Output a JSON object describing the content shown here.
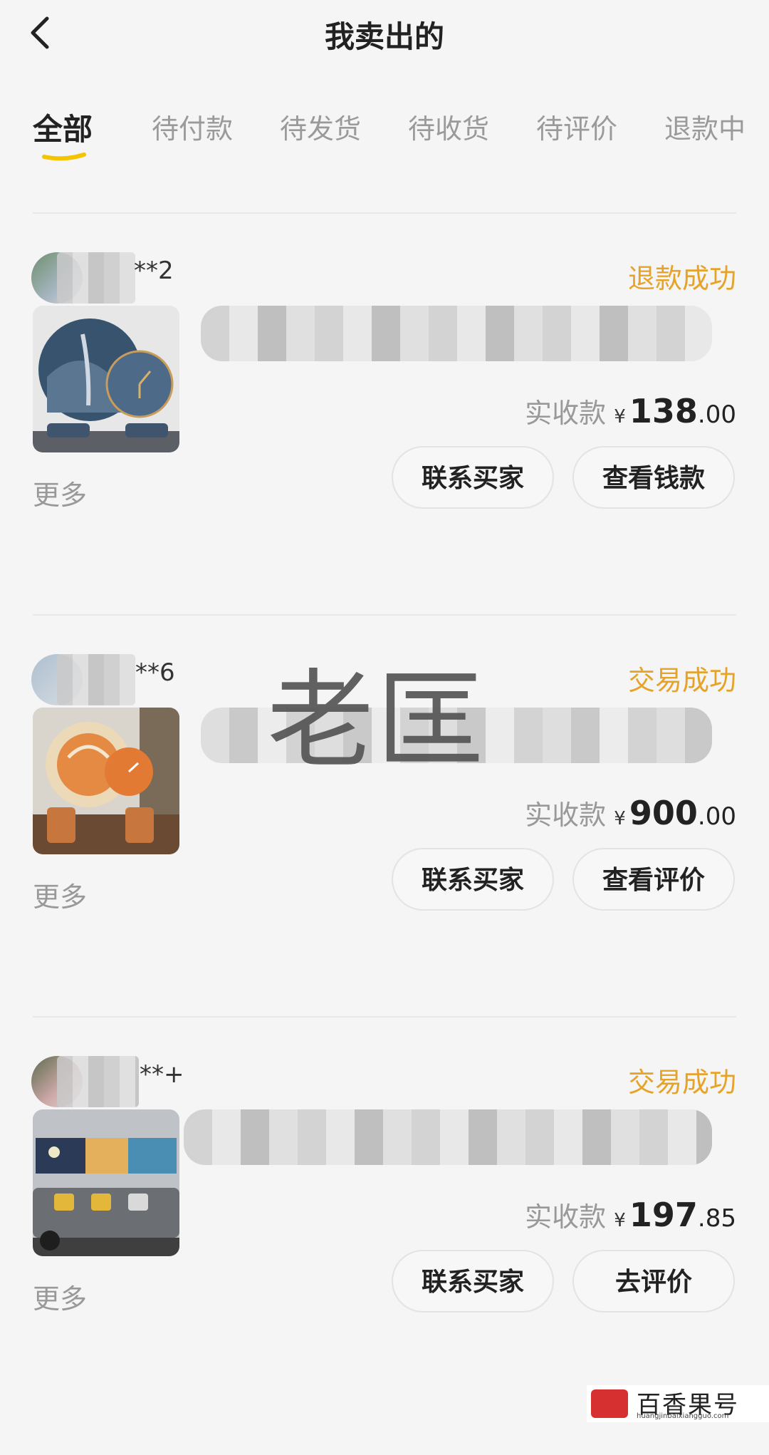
{
  "header": {
    "title": "我卖出的",
    "back_icon": "chevron-left-icon"
  },
  "tabs": [
    {
      "label": "全部",
      "active": true
    },
    {
      "label": "待付款"
    },
    {
      "label": "待发货"
    },
    {
      "label": "待收货"
    },
    {
      "label": "待评价"
    },
    {
      "label": "退款中"
    }
  ],
  "colors": {
    "accent": "#e6a32a",
    "underline": "#f5c400"
  },
  "orders": [
    {
      "buyer_suffix": "**2",
      "status": "退款成功",
      "pay_label": "实收款",
      "currency": "¥",
      "amount_int": "138",
      "amount_dec": ".00",
      "more": "更多",
      "btn1": "联系买家",
      "btn2": "查看钱款"
    },
    {
      "buyer_suffix": "**6",
      "status": "交易成功",
      "pay_label": "实收款",
      "currency": "¥",
      "amount_int": "900",
      "amount_dec": ".00",
      "more": "更多",
      "btn1": "联系买家",
      "btn2": "查看评价"
    },
    {
      "buyer_suffix": "**+",
      "status": "交易成功",
      "pay_label": "实收款",
      "currency": "¥",
      "amount_int": "197",
      "amount_dec": ".85",
      "more": "更多",
      "btn1": "联系买家",
      "btn2": "去评价"
    }
  ],
  "watermark": "老匡",
  "corner_logo": {
    "text": "百香果号",
    "url": "huangjinbaixiangguo.com"
  }
}
